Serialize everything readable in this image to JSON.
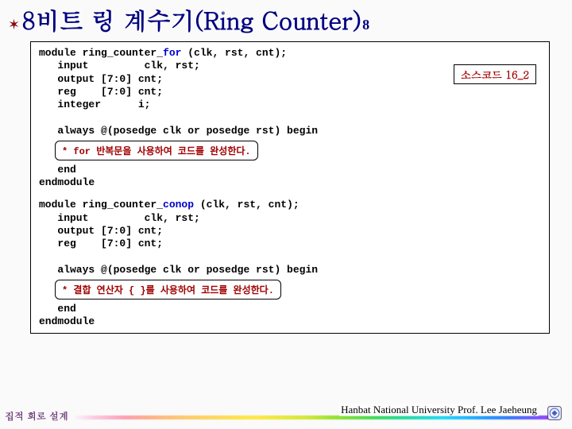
{
  "title": {
    "main": "8비트 링 계수기(Ring Counter)",
    "sub": "8"
  },
  "source_label": "소스코드 16_2",
  "code1": {
    "line1a": "module ring_counter_",
    "line1b": "for",
    "line1c": " (clk, rst, cnt);",
    "line2": "   input         clk, rst;",
    "line3": "   output [7:0] cnt;",
    "line4": "   reg    [7:0] cnt;",
    "line5": "   integer      i;",
    "blank": " ",
    "line6": "   always @(posedge clk or posedge rst) begin",
    "note": "* for 반복문을 사용하여 코드를 완성한다.",
    "line7": "   end",
    "line8": "endmodule"
  },
  "code2": {
    "line1a": "module ring_counter_",
    "line1b": "conop",
    "line1c": " (clk, rst, cnt);",
    "line2": "   input         clk, rst;",
    "line3": "   output [7:0] cnt;",
    "line4": "   reg    [7:0] cnt;",
    "blank": " ",
    "line5": "   always @(posedge clk or posedge rst) begin",
    "note": "* 결합 연산자 { }를 사용하여 코드를 완성한다.",
    "line6": "   end",
    "line7": "endmodule"
  },
  "footer": {
    "left": "집적 회로 설계",
    "right": "Hanbat National University Prof. Lee Jaeheung"
  }
}
